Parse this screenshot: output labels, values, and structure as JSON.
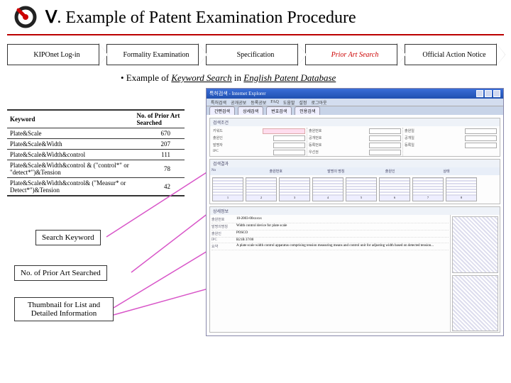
{
  "header": {
    "roman": "Ⅴ",
    "title": ". Example of Patent Examination Procedure"
  },
  "arrows": [
    {
      "label": "KIPOnet Log-in",
      "active": false
    },
    {
      "label": "Formality Examination",
      "active": false
    },
    {
      "label": "Specification",
      "active": false
    },
    {
      "label": "Prior Art Search",
      "active": true
    },
    {
      "label": "Official Action Notice",
      "active": false
    }
  ],
  "example_line": {
    "prefix": "• Example of ",
    "kw": "Keyword Search",
    "mid": " in ",
    "db": "English Patent Database"
  },
  "kw_table": {
    "head_kw": "Keyword",
    "head_num": "No. of Prior Art Searched",
    "rows": [
      {
        "kw": "Plate&Scale",
        "num": "670"
      },
      {
        "kw": "Plate&Scale&Width",
        "num": "207"
      },
      {
        "kw": "Plate&Scale&Width&control",
        "num": "111"
      },
      {
        "kw": "Plate&Scale&Width&control & (\"control*\" or \"detect*\")&Tension",
        "num": "78"
      },
      {
        "kw": "Plate&Scale&Width&control& (\"Measur* or Detect*\")&Tension",
        "num": "42"
      }
    ]
  },
  "callouts": {
    "c1": "Search Keyword",
    "c2": "No. of Prior Art Searched",
    "c3": "Thumbnail for List and Detailed Information"
  },
  "screenshot": {
    "panel1": "검색조건",
    "panel2": "검색결과",
    "panel3": "상세정보"
  }
}
